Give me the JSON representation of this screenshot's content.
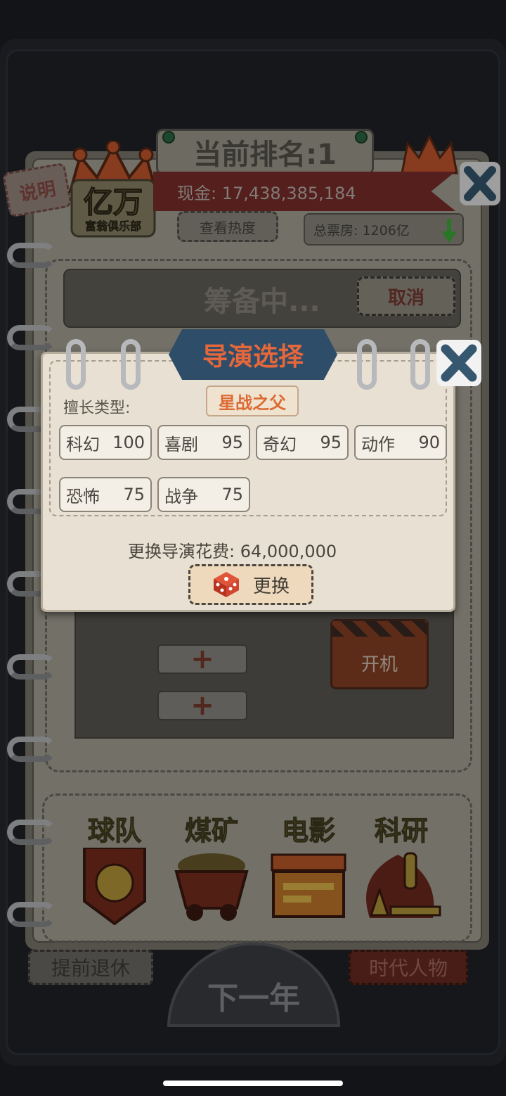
{
  "header": {
    "rank_label": "当前排名:1",
    "help_label": "说明",
    "club_logo_main": "亿万",
    "club_logo_sub": "富翁俱乐部",
    "cash_label": "现金: 17,438,385,184",
    "view_heat_label": "查看热度",
    "box_office_label": "总票房: 1206亿"
  },
  "production": {
    "status_label": "筹备中...",
    "cancel_label": "取消",
    "start_label": "开机"
  },
  "categories": [
    {
      "label": "球队"
    },
    {
      "label": "煤矿"
    },
    {
      "label": "电影"
    },
    {
      "label": "科研"
    }
  ],
  "footer": {
    "retire_label": "提前退休",
    "era_label": "时代人物",
    "next_year_label": "下一年"
  },
  "modal": {
    "title": "导演选择",
    "specialty_label": "擅长类型:",
    "director_name": "星战之父",
    "genres": [
      {
        "name": "科幻",
        "score": "100"
      },
      {
        "name": "喜剧",
        "score": "95"
      },
      {
        "name": "奇幻",
        "score": "95"
      },
      {
        "name": "动作",
        "score": "90"
      },
      {
        "name": "恐怖",
        "score": "75"
      },
      {
        "name": "战争",
        "score": "75"
      }
    ],
    "cost_label": "更换导演花费: 64,000,000",
    "change_label": "更换"
  },
  "colors": {
    "accent_orange": "#dc6a33",
    "title_plate": "#2e4d68",
    "banner_red": "#7c2f2b",
    "down_arrow": "#3fae3a"
  }
}
